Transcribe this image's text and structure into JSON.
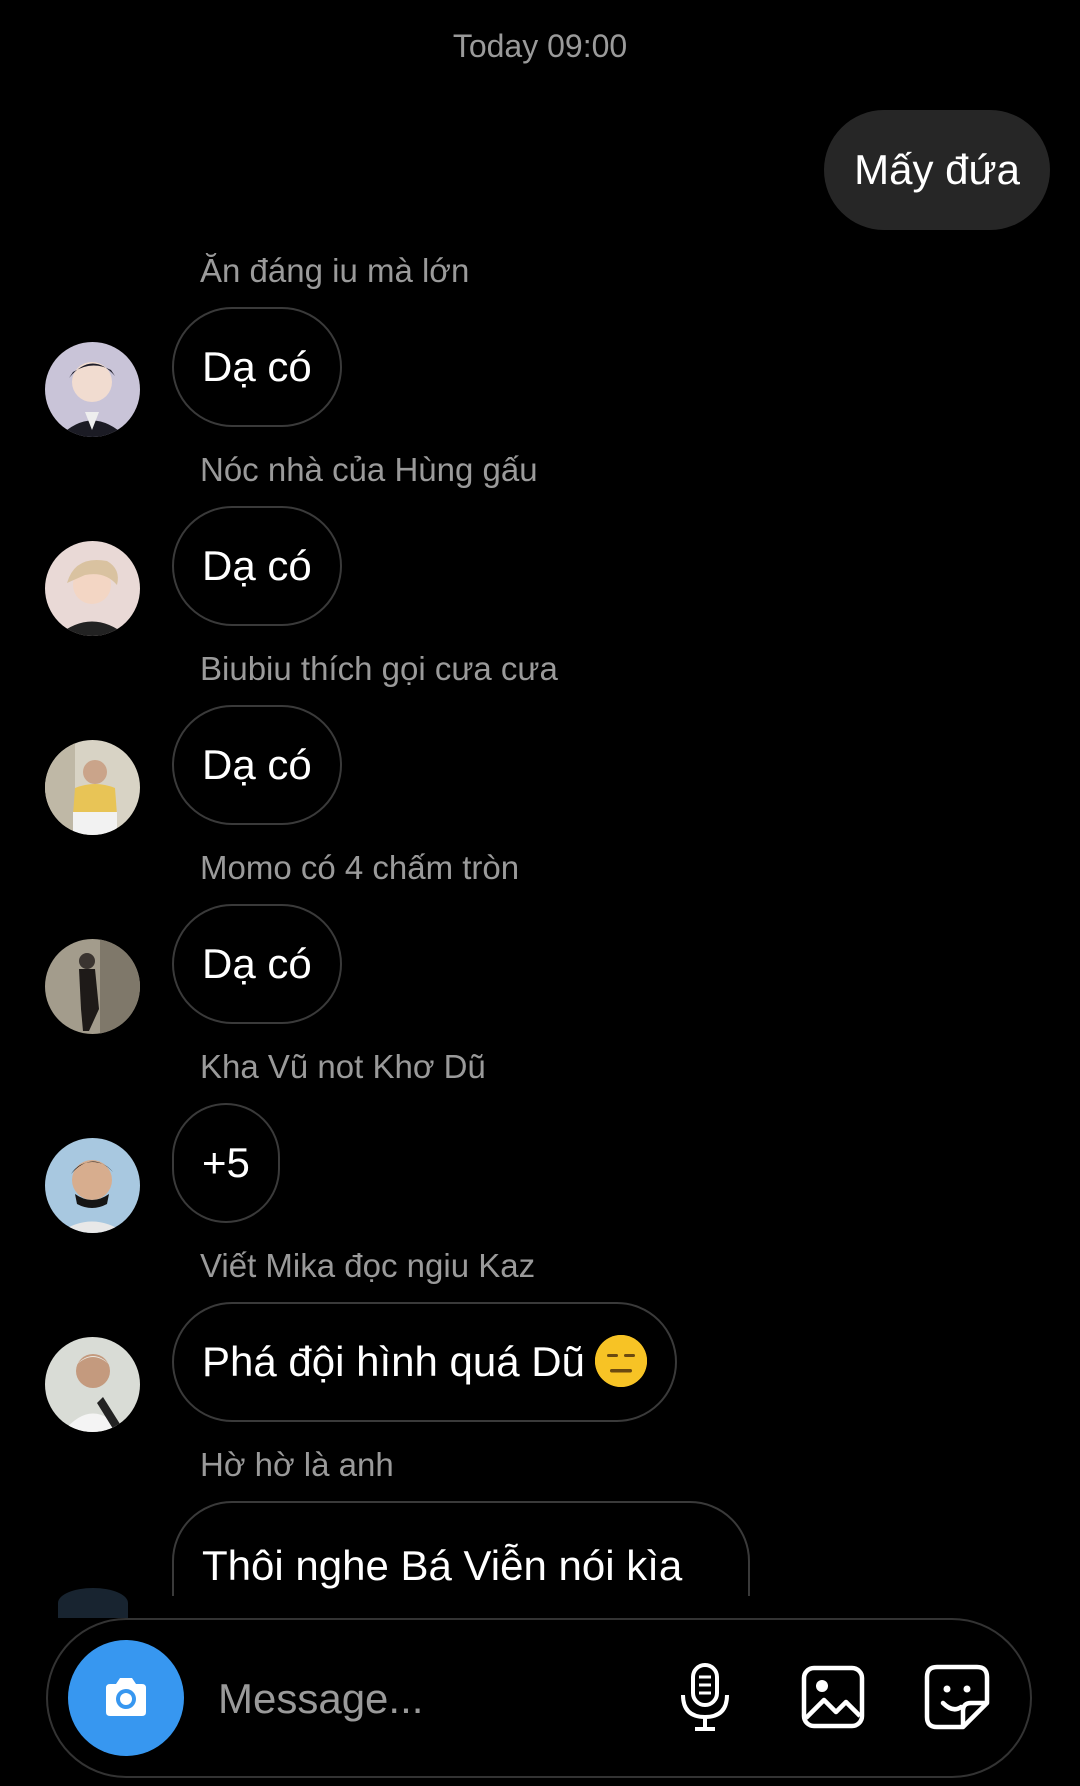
{
  "thread": {
    "timestamp": "Today 09:00",
    "outgoing_message": "Mấy đứa"
  },
  "messages": [
    {
      "sender": "Ăn đáng iu mà lớn",
      "text": "Dạ có"
    },
    {
      "sender": "Nóc nhà của Hùng gấu",
      "text": "Dạ có"
    },
    {
      "sender": "Biubiu thích gọi cưa cưa",
      "text": "Dạ có"
    },
    {
      "sender": "Momo có 4 chấm tròn",
      "text": "Dạ có"
    },
    {
      "sender": "Kha Vũ not Khơ Dũ",
      "text": "+5"
    },
    {
      "sender": "Viết Mika đọc ngiu Kaz",
      "text": "Phá đội hình quá Dũ",
      "emoji": "expressionless-face-icon"
    },
    {
      "sender": "Hờ hờ là anh",
      "text": "Thôi nghe Bá Viễn nói kìa"
    }
  ],
  "composer": {
    "placeholder": "Message...",
    "icons": [
      "camera-icon",
      "microphone-icon",
      "gallery-icon",
      "sticker-icon"
    ],
    "camera_bg": "#3797f0"
  }
}
